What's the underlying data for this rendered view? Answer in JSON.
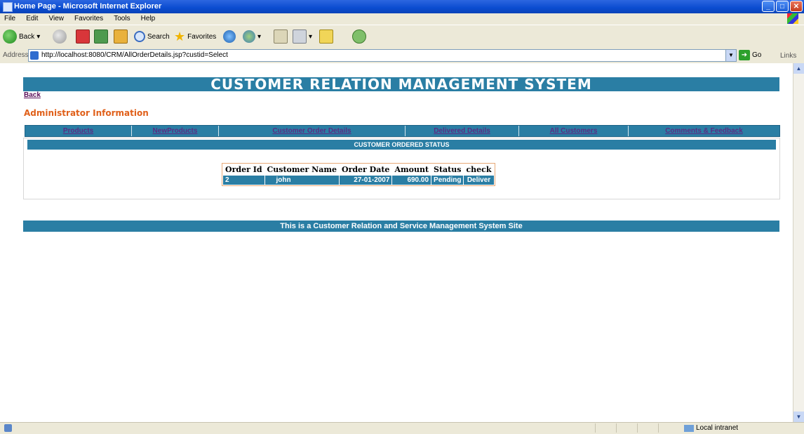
{
  "window": {
    "title": "Home Page - Microsoft Internet Explorer",
    "buttons": {
      "minimize": "_",
      "maximize": "□",
      "close": "✕"
    }
  },
  "menubar": {
    "items": [
      "File",
      "Edit",
      "View",
      "Favorites",
      "Tools",
      "Help"
    ]
  },
  "toolbar": {
    "back_label": "Back",
    "search_label": "Search",
    "favorites_label": "Favorites"
  },
  "address": {
    "label": "Address",
    "url": "http://localhost:8080/CRM/AllOrderDetails.jsp?custid=Select",
    "go_label": "Go",
    "links_label": "Links"
  },
  "page": {
    "title": "CUSTOMER RELATION MANAGEMENT SYSTEM",
    "back_link": "Back",
    "admin_heading": "Administrator Information",
    "nav": [
      "Products",
      "NewProducts",
      "Customer Order Details",
      "Delivered Details",
      "All Customers",
      "Comments & Feedback"
    ],
    "status_heading": "CUSTOMER ORDERED STATUS",
    "table": {
      "headers": [
        "Order Id",
        "Customer Name",
        "Order Date",
        "Amount",
        "Status",
        "check"
      ],
      "rows": [
        [
          "2",
          "john",
          "27-01-2007",
          "690.00",
          "Pending",
          "Deliver"
        ]
      ]
    },
    "footer": "This is a Customer Relation and Service Management System Site"
  },
  "statusbar": {
    "zone": "Local intranet"
  },
  "colors": {
    "accent": "#2a7ea4",
    "link": "#5b2c83",
    "heading": "#e0601a",
    "titlebar": "#0a4cd0"
  }
}
